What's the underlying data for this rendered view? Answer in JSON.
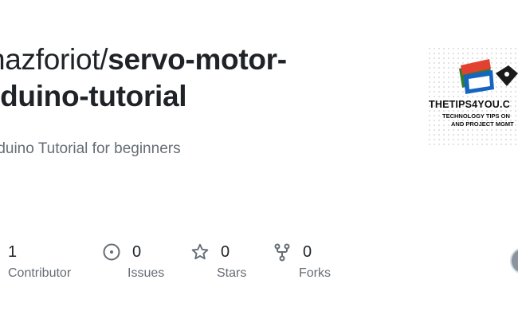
{
  "repo": {
    "owner": "hazforiot/",
    "name_line1": "servo-motor-",
    "name_line2": "rduino-tutorial",
    "description": "rduino Tutorial for beginners"
  },
  "stats": [
    {
      "count": "1",
      "label": "Contributor",
      "icon": "people-icon"
    },
    {
      "count": "0",
      "label": "Issues",
      "icon": "issue-opened-icon"
    },
    {
      "count": "0",
      "label": "Stars",
      "icon": "star-icon"
    },
    {
      "count": "0",
      "label": "Forks",
      "icon": "repo-forked-icon"
    }
  ],
  "logo": {
    "line1": "THETIPS4YOU.C",
    "line2": "TECHNOLOGY TIPS ON",
    "line3": "AND PROJECT MGMT",
    "colors": {
      "red": "#e2412f",
      "blue": "#1565c0",
      "green": "#2e7d32"
    }
  },
  "colors": {
    "text": "#1f2328",
    "muted": "#656d76",
    "icon": "#656d76"
  }
}
